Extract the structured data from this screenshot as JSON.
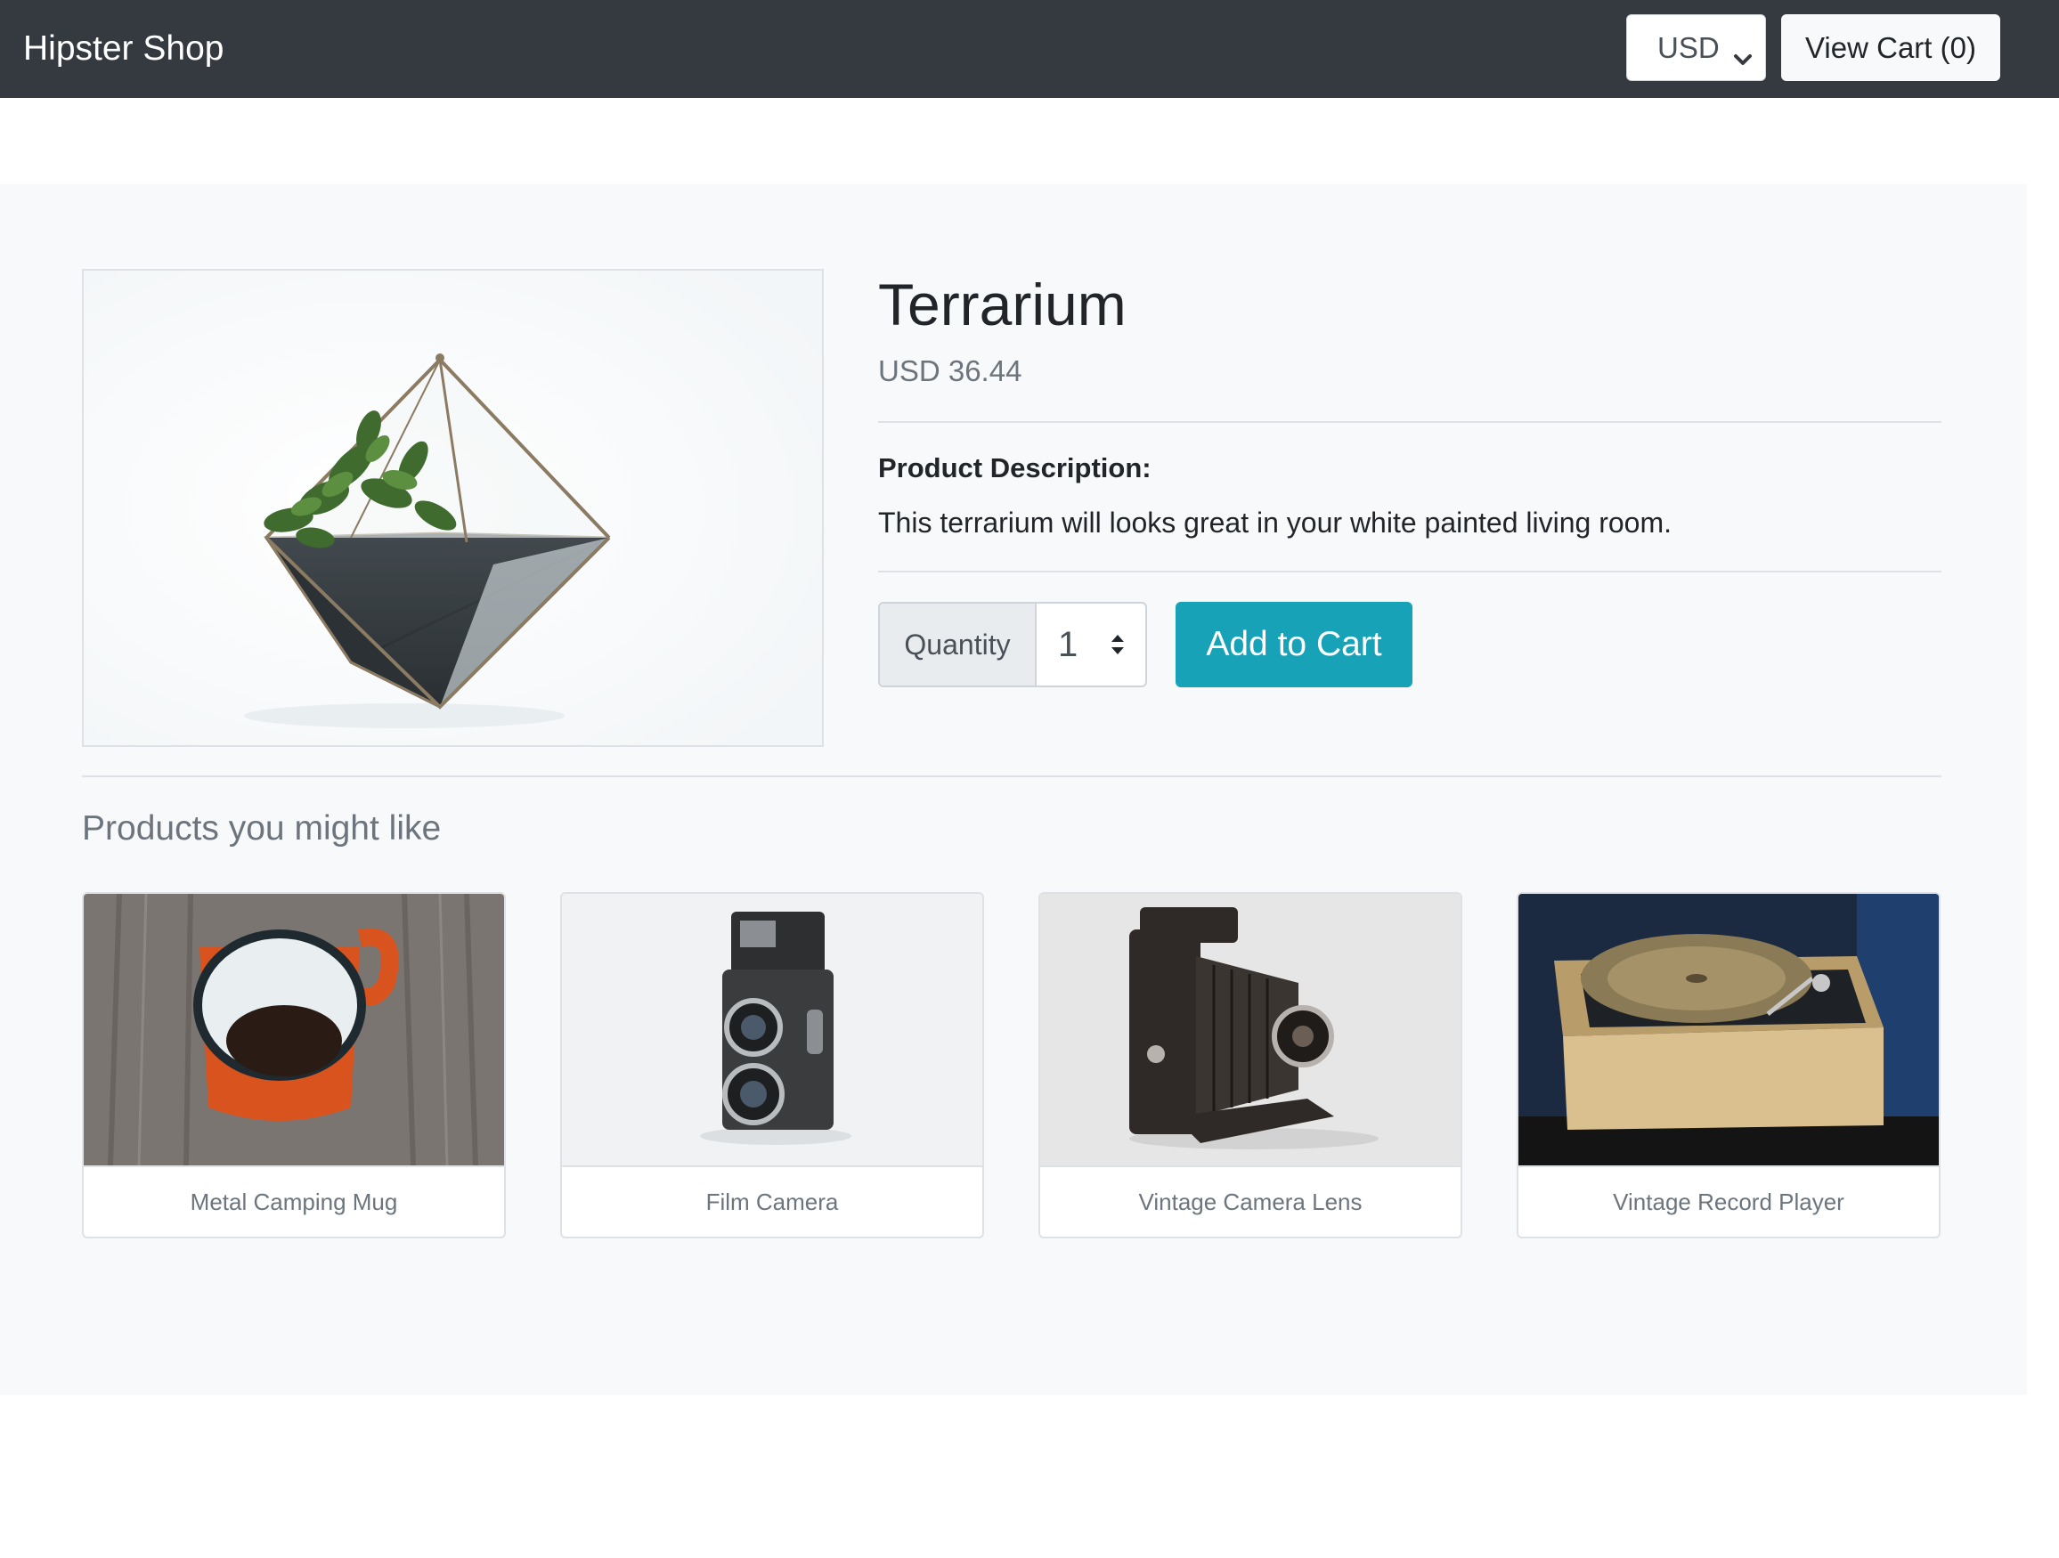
{
  "navbar": {
    "brand": "Hipster Shop",
    "currency": "USD",
    "view_cart_label": "View Cart (0)"
  },
  "product": {
    "name": "Terrarium",
    "price": "USD 36.44",
    "description_heading": "Product Description:",
    "description": "This terrarium will looks great in your white painted living room.",
    "quantity_label": "Quantity",
    "quantity_value": "1",
    "add_to_cart_label": "Add to Cart"
  },
  "recommendations": {
    "title": "Products you might like",
    "items": [
      {
        "name": "Metal Camping Mug"
      },
      {
        "name": "Film Camera"
      },
      {
        "name": "Vintage Camera Lens"
      },
      {
        "name": "Vintage Record Player"
      }
    ]
  },
  "colors": {
    "navbar_bg": "#343a40",
    "panel_bg": "#f8f9fa",
    "primary_button": "#17a2b8",
    "muted_text": "#6c757d"
  },
  "icons": {
    "currency_dropdown": "chevron-down-icon",
    "quantity_spinner": "spinner-arrows-icon"
  }
}
